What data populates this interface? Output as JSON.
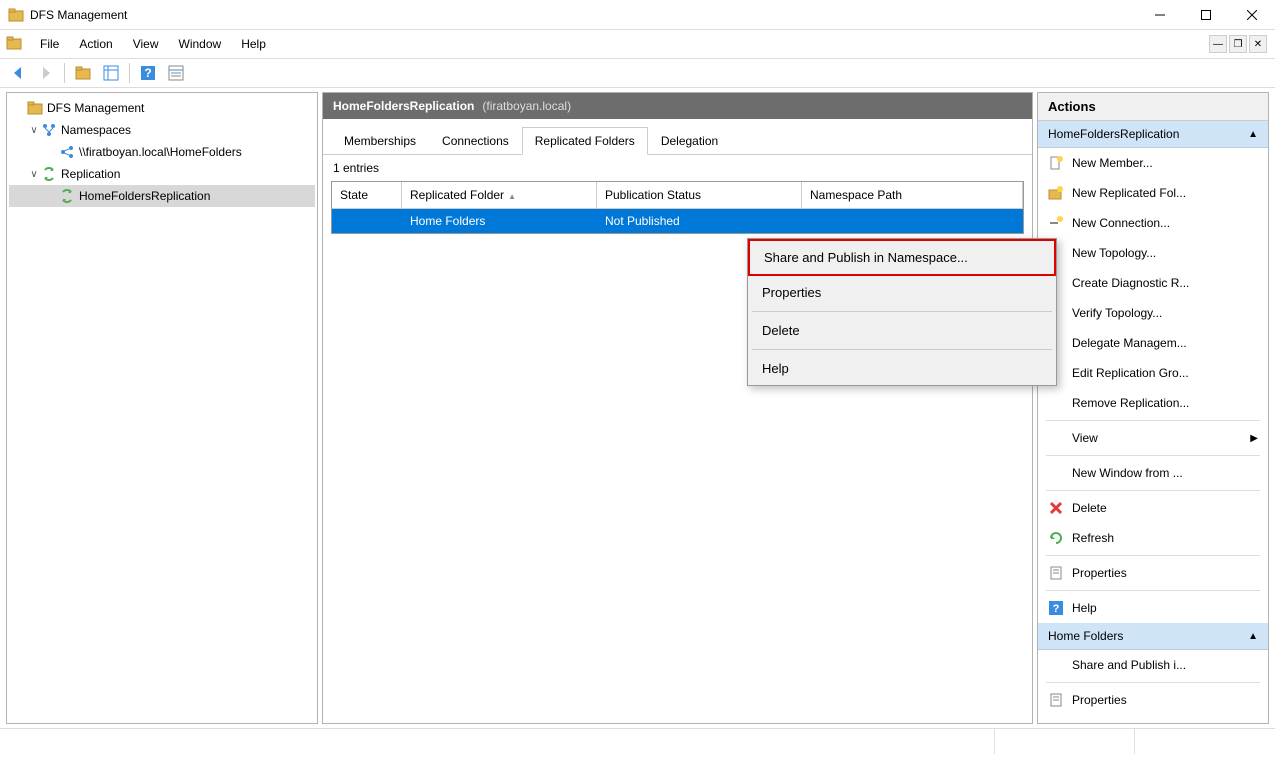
{
  "window": {
    "title": "DFS Management"
  },
  "menu": {
    "items": [
      "File",
      "Action",
      "View",
      "Window",
      "Help"
    ]
  },
  "tree": {
    "root": {
      "label": "DFS Management"
    },
    "namespaces": {
      "label": "Namespaces"
    },
    "ns_path": {
      "label": "\\\\firatboyan.local\\HomeFolders"
    },
    "replication": {
      "label": "Replication"
    },
    "rep_group": {
      "label": "HomeFoldersReplication"
    }
  },
  "main": {
    "header": {
      "name": "HomeFoldersReplication",
      "sub": "(firatboyan.local)"
    },
    "tabs": [
      "Memberships",
      "Connections",
      "Replicated Folders",
      "Delegation"
    ],
    "active_tab": 2,
    "entries_text": "1 entries",
    "columns": [
      "State",
      "Replicated Folder",
      "Publication Status",
      "Namespace Path"
    ],
    "row": {
      "state": "",
      "folder": "Home Folders",
      "pub": "Not Published",
      "ns": ""
    }
  },
  "context": {
    "items": [
      "Share and Publish in Namespace...",
      "Properties",
      "Delete",
      "Help"
    ]
  },
  "actions": {
    "title": "Actions",
    "section1": "HomeFoldersReplication",
    "group1": [
      "New Member...",
      "New Replicated Fol...",
      "New Connection...",
      "New Topology...",
      "Create Diagnostic R...",
      "Verify Topology...",
      "Delegate Managem...",
      "Edit Replication Gro...",
      "Remove Replication..."
    ],
    "view_label": "View",
    "newwin_label": "New Window from ...",
    "delete_label": "Delete",
    "refresh_label": "Refresh",
    "props_label": "Properties",
    "help_label": "Help",
    "section2": "Home Folders",
    "group2": [
      "Share and Publish i...",
      "Properties"
    ]
  }
}
